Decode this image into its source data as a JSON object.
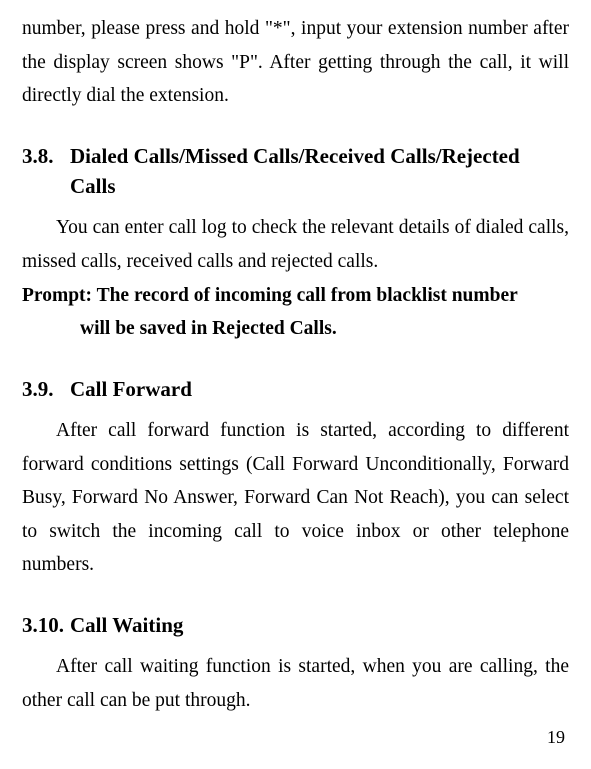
{
  "continuation": "number, please press and hold \"*\", input your extension number after the display screen shows \"P\". After getting through the call, it will directly dial the extension.",
  "sections": {
    "s38": {
      "number": "3.8.",
      "title": "Dialed Calls/Missed Calls/Received Calls/Rejected Calls",
      "body": "You can enter call log to check the relevant details of dialed calls, missed calls, received calls and rejected calls.",
      "prompt_label": "Prompt: ",
      "prompt_line1": "The record of incoming call from blacklist number",
      "prompt_line2": "will be saved in Rejected Calls."
    },
    "s39": {
      "number": "3.9.",
      "title": "Call Forward",
      "body": "After call forward function is started, according to different forward conditions settings (Call Forward Unconditionally, Forward Busy, Forward No Answer, Forward Can Not Reach), you can select to switch the incoming call to voice inbox or other telephone numbers."
    },
    "s310": {
      "number": "3.10.",
      "title": "Call Waiting",
      "body": "After call waiting function is started, when you are calling, the other call can be put through."
    }
  },
  "page_number": "19"
}
